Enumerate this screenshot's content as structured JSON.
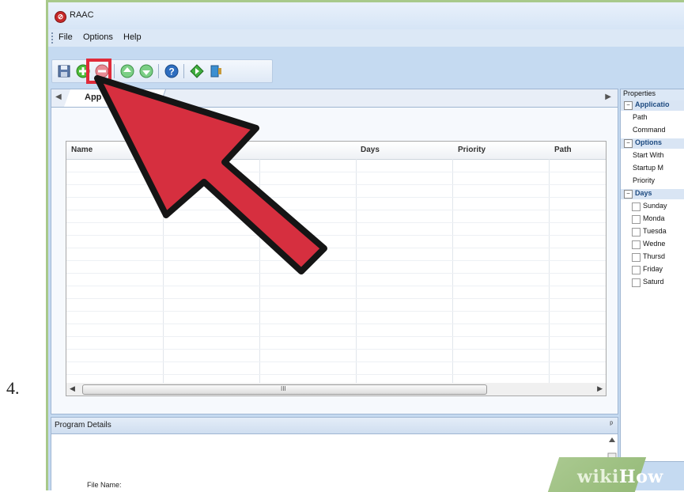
{
  "step_number": "4.",
  "window": {
    "title": "RAAC"
  },
  "menu": {
    "items": [
      "File",
      "Options",
      "Help"
    ]
  },
  "toolbar": {
    "buttons": [
      "save-icon",
      "add-program-icon",
      "remove-program-icon",
      "move-up-icon",
      "move-down-icon",
      "help-icon",
      "run-icon",
      "exit-icon"
    ],
    "highlighted": "add-program-icon"
  },
  "main_tab": {
    "label": "App"
  },
  "program_list": {
    "columns": [
      "Name",
      "Days",
      "Priority",
      "Path"
    ],
    "scroll_grip": "III"
  },
  "properties": {
    "title": "Properties",
    "rows": [
      {
        "type": "category",
        "label": "Applicatio"
      },
      {
        "type": "item",
        "label": "Path"
      },
      {
        "type": "item",
        "label": "Command"
      },
      {
        "type": "category",
        "label": "Options"
      },
      {
        "type": "item",
        "label": "Start With"
      },
      {
        "type": "item",
        "label": "Startup M"
      },
      {
        "type": "item",
        "label": "Priority"
      },
      {
        "type": "category",
        "label": "Days"
      },
      {
        "type": "check",
        "label": "Sunday"
      },
      {
        "type": "check",
        "label": "Monda"
      },
      {
        "type": "check",
        "label": "Tuesda"
      },
      {
        "type": "check",
        "label": "Wedne"
      },
      {
        "type": "check",
        "label": "Thursd"
      },
      {
        "type": "check",
        "label": "Friday"
      },
      {
        "type": "check",
        "label": "Saturd"
      }
    ]
  },
  "program_details": {
    "title": "Program Details",
    "file_name_label": "File Name:"
  },
  "watermark": {
    "part1": "wiki",
    "part2": "How"
  },
  "colors": {
    "highlight": "#e02b3a",
    "arrow": "#d62f3f",
    "frame": "#a8c98b"
  }
}
